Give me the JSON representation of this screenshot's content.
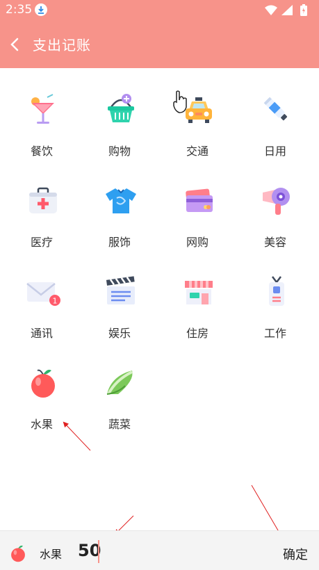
{
  "status_bar": {
    "time": "2:35"
  },
  "header": {
    "title": "支出记账"
  },
  "categories": [
    {
      "label": "餐饮",
      "icon": "cocktail-icon"
    },
    {
      "label": "购物",
      "icon": "basket-icon"
    },
    {
      "label": "交通",
      "icon": "taxi-icon"
    },
    {
      "label": "日用",
      "icon": "toothpaste-icon"
    },
    {
      "label": "医疗",
      "icon": "medical-kit-icon"
    },
    {
      "label": "服饰",
      "icon": "shirt-icon"
    },
    {
      "label": "网购",
      "icon": "cards-icon"
    },
    {
      "label": "美容",
      "icon": "hair-dryer-icon"
    },
    {
      "label": "通讯",
      "icon": "envelope-icon"
    },
    {
      "label": "娱乐",
      "icon": "clapperboard-icon"
    },
    {
      "label": "住房",
      "icon": "shop-icon"
    },
    {
      "label": "工作",
      "icon": "badge-icon"
    },
    {
      "label": "水果",
      "icon": "apple-icon"
    },
    {
      "label": "蔬菜",
      "icon": "cabbage-icon"
    }
  ],
  "message_badge": "1",
  "bottom_bar": {
    "category_label": "水果",
    "amount": "50",
    "confirm_label": "确定"
  },
  "colors": {
    "accent": "#f7938a"
  }
}
